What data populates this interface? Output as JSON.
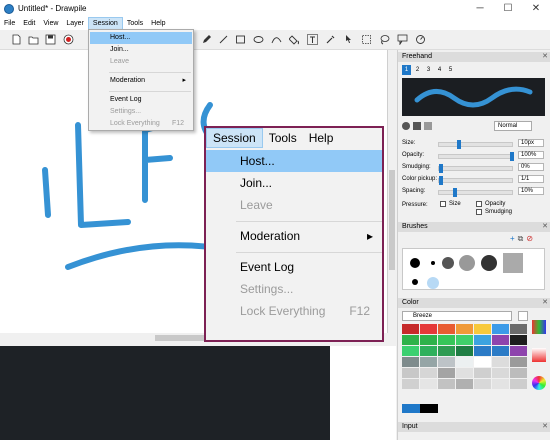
{
  "titlebar": {
    "title": "Untitled* - Drawpile",
    "minimize": "─",
    "maximize": "☐",
    "close": "✕"
  },
  "menubar": {
    "items": [
      "File",
      "Edit",
      "View",
      "Layer",
      "Session",
      "Tools",
      "Help"
    ]
  },
  "session_menu": {
    "items": [
      {
        "label": "Host...",
        "state": "highlighted"
      },
      {
        "label": "Join...",
        "state": "enabled"
      },
      {
        "label": "Leave",
        "state": "disabled"
      },
      {
        "label": "Moderation",
        "state": "enabled",
        "submenu": "▸"
      },
      {
        "label": "Event Log",
        "state": "enabled"
      },
      {
        "label": "Settings...",
        "state": "disabled"
      },
      {
        "label": "Lock Everything",
        "shortcut": "F12",
        "state": "disabled"
      }
    ]
  },
  "zoom_popup": {
    "menubar": [
      "Session",
      "Tools",
      "Help"
    ],
    "items": [
      {
        "label": "Host...",
        "state": "highlighted"
      },
      {
        "label": "Join...",
        "state": "enabled"
      },
      {
        "label": "Leave",
        "state": "disabled"
      },
      {
        "label": "Moderation",
        "state": "enabled",
        "submenu": "▸"
      },
      {
        "label": "Event Log",
        "state": "enabled"
      },
      {
        "label": "Settings...",
        "state": "disabled"
      },
      {
        "label": "Lock Everything",
        "shortcut": "F12",
        "state": "disabled"
      }
    ]
  },
  "freehand": {
    "title": "Freehand",
    "presets": [
      "1",
      "2",
      "3",
      "4",
      "5"
    ],
    "blend_mode": "Normal",
    "size_label": "Size:",
    "size_value": "10px",
    "opacity_label": "Opacity:",
    "opacity_value": "100%",
    "smudging_label": "Smudging:",
    "smudging_value": "0%",
    "color_pickup_label": "Color pickup:",
    "color_pickup_value": "1/1",
    "spacing_label": "Spacing:",
    "spacing_value": "10%",
    "pressure_label": "Pressure:",
    "pressure_size": "Size",
    "pressure_opacity": "Opacity",
    "pressure_smudging": "Smudging",
    "levels": {
      "size": 0.25,
      "opacity": 1.0,
      "smudging": 0.0,
      "color_pickup": 0.0,
      "spacing": 0.2
    }
  },
  "brushes": {
    "title": "Brushes"
  },
  "color": {
    "title": "Color",
    "palette_name": "Breeze"
  },
  "input": {
    "title": "Input"
  },
  "colors": {
    "accent": "#1f78c8",
    "stroke": "#3592d4",
    "popup_border": "#7d2154",
    "highlight": "#91c9f7",
    "palette": [
      [
        "#c62a2a",
        "#e53838",
        "#e85c32",
        "#f09a38",
        "#f7c93c",
        "#3c9be8",
        "#6b6b6b"
      ],
      [
        "#2eb24a",
        "#2eb24a",
        "#36c659",
        "#3fd06a",
        "#3ca3e0",
        "#8e44ad",
        "#1e1e1e"
      ],
      [
        "#3bd070",
        "#2fb05c",
        "#2f9c53",
        "#1f7e44",
        "#2b7bc6",
        "#2b7bc6",
        "#8e44ad"
      ],
      [
        "#7f8c8d",
        "#95a5a6",
        "#bdc3c7",
        "#ecf0f1",
        "#ffffff",
        "#dcdcdc",
        "#9b9b9b"
      ],
      [
        "#c8c8c8",
        "#d6d6d6",
        "#a4a4a4",
        "#e0e0e0",
        "#cfcfcf",
        "#d9d9d9",
        "#bcbcbc"
      ],
      [
        "#d0d0d0",
        "#e5e5e5",
        "#c2c2c2",
        "#b0b0b0",
        "#d8d8d8",
        "#e3e3e3",
        "#cdcdcd"
      ]
    ]
  },
  "icons": {
    "app": "drawpile-icon",
    "new": "new-file-icon",
    "open": "open-folder-icon",
    "save": "save-icon",
    "record": "record-icon"
  }
}
